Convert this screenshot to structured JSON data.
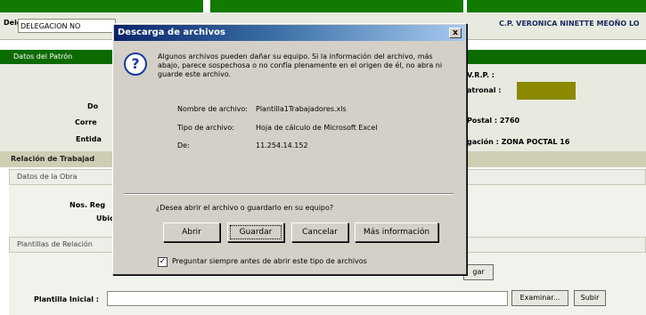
{
  "header": {
    "dele_prefix": "Delg.:",
    "dele_value": "DELEGACION NO",
    "right_name": "C.P. VERONICA NINETTE MEOÑO LO"
  },
  "page": {
    "band_title": "Datos del Patrón",
    "vrp_label": "V.R.P. :",
    "patronal_label": "atronal :",
    "postal_label": "Postal : 2760",
    "ubicacion_label": "gación : ZONA POCTAL 16",
    "do_label": "Do",
    "corre_label": "Corre",
    "entida_label": "Entida",
    "relacion_title": "Relación de Trabajad",
    "obra_title": "Datos de la Obra",
    "noreg_label": "Nos. Reg",
    "ubic_label": "Ubic",
    "plantillas_title": "Plantillas de Relación",
    "agar_label": "gar",
    "plantilla_label": "Plantilla Inicial :",
    "examinar_label": "Examinar...",
    "subir_label": "Subir"
  },
  "dialog": {
    "title": "Descarga de archivos",
    "close": "x",
    "warning": "Algunos archivos pueden dañar su equipo. Si la información del archivo, más abajo, parece sospechosa o no confía plenamente en el origen de él, no abra ni guarde este archivo.",
    "name_key": "Nombre de archivo:",
    "name_val": "Plantilla1Trabajadores.xls",
    "type_key": "Tipo de archivo:",
    "type_val": "Hoja de cálculo de Microsoft Excel",
    "from_key": "De:",
    "from_val": "11.254.14.152",
    "question": "¿Desea abrir el archivo o guardarlo en su equipo?",
    "btn_open": "Abrir",
    "btn_save": "Guardar",
    "btn_cancel": "Cancelar",
    "btn_more": "Más información",
    "checkbox_label": "Preguntar siempre antes de abrir este tipo de archivos",
    "checkbox_checked": true
  }
}
